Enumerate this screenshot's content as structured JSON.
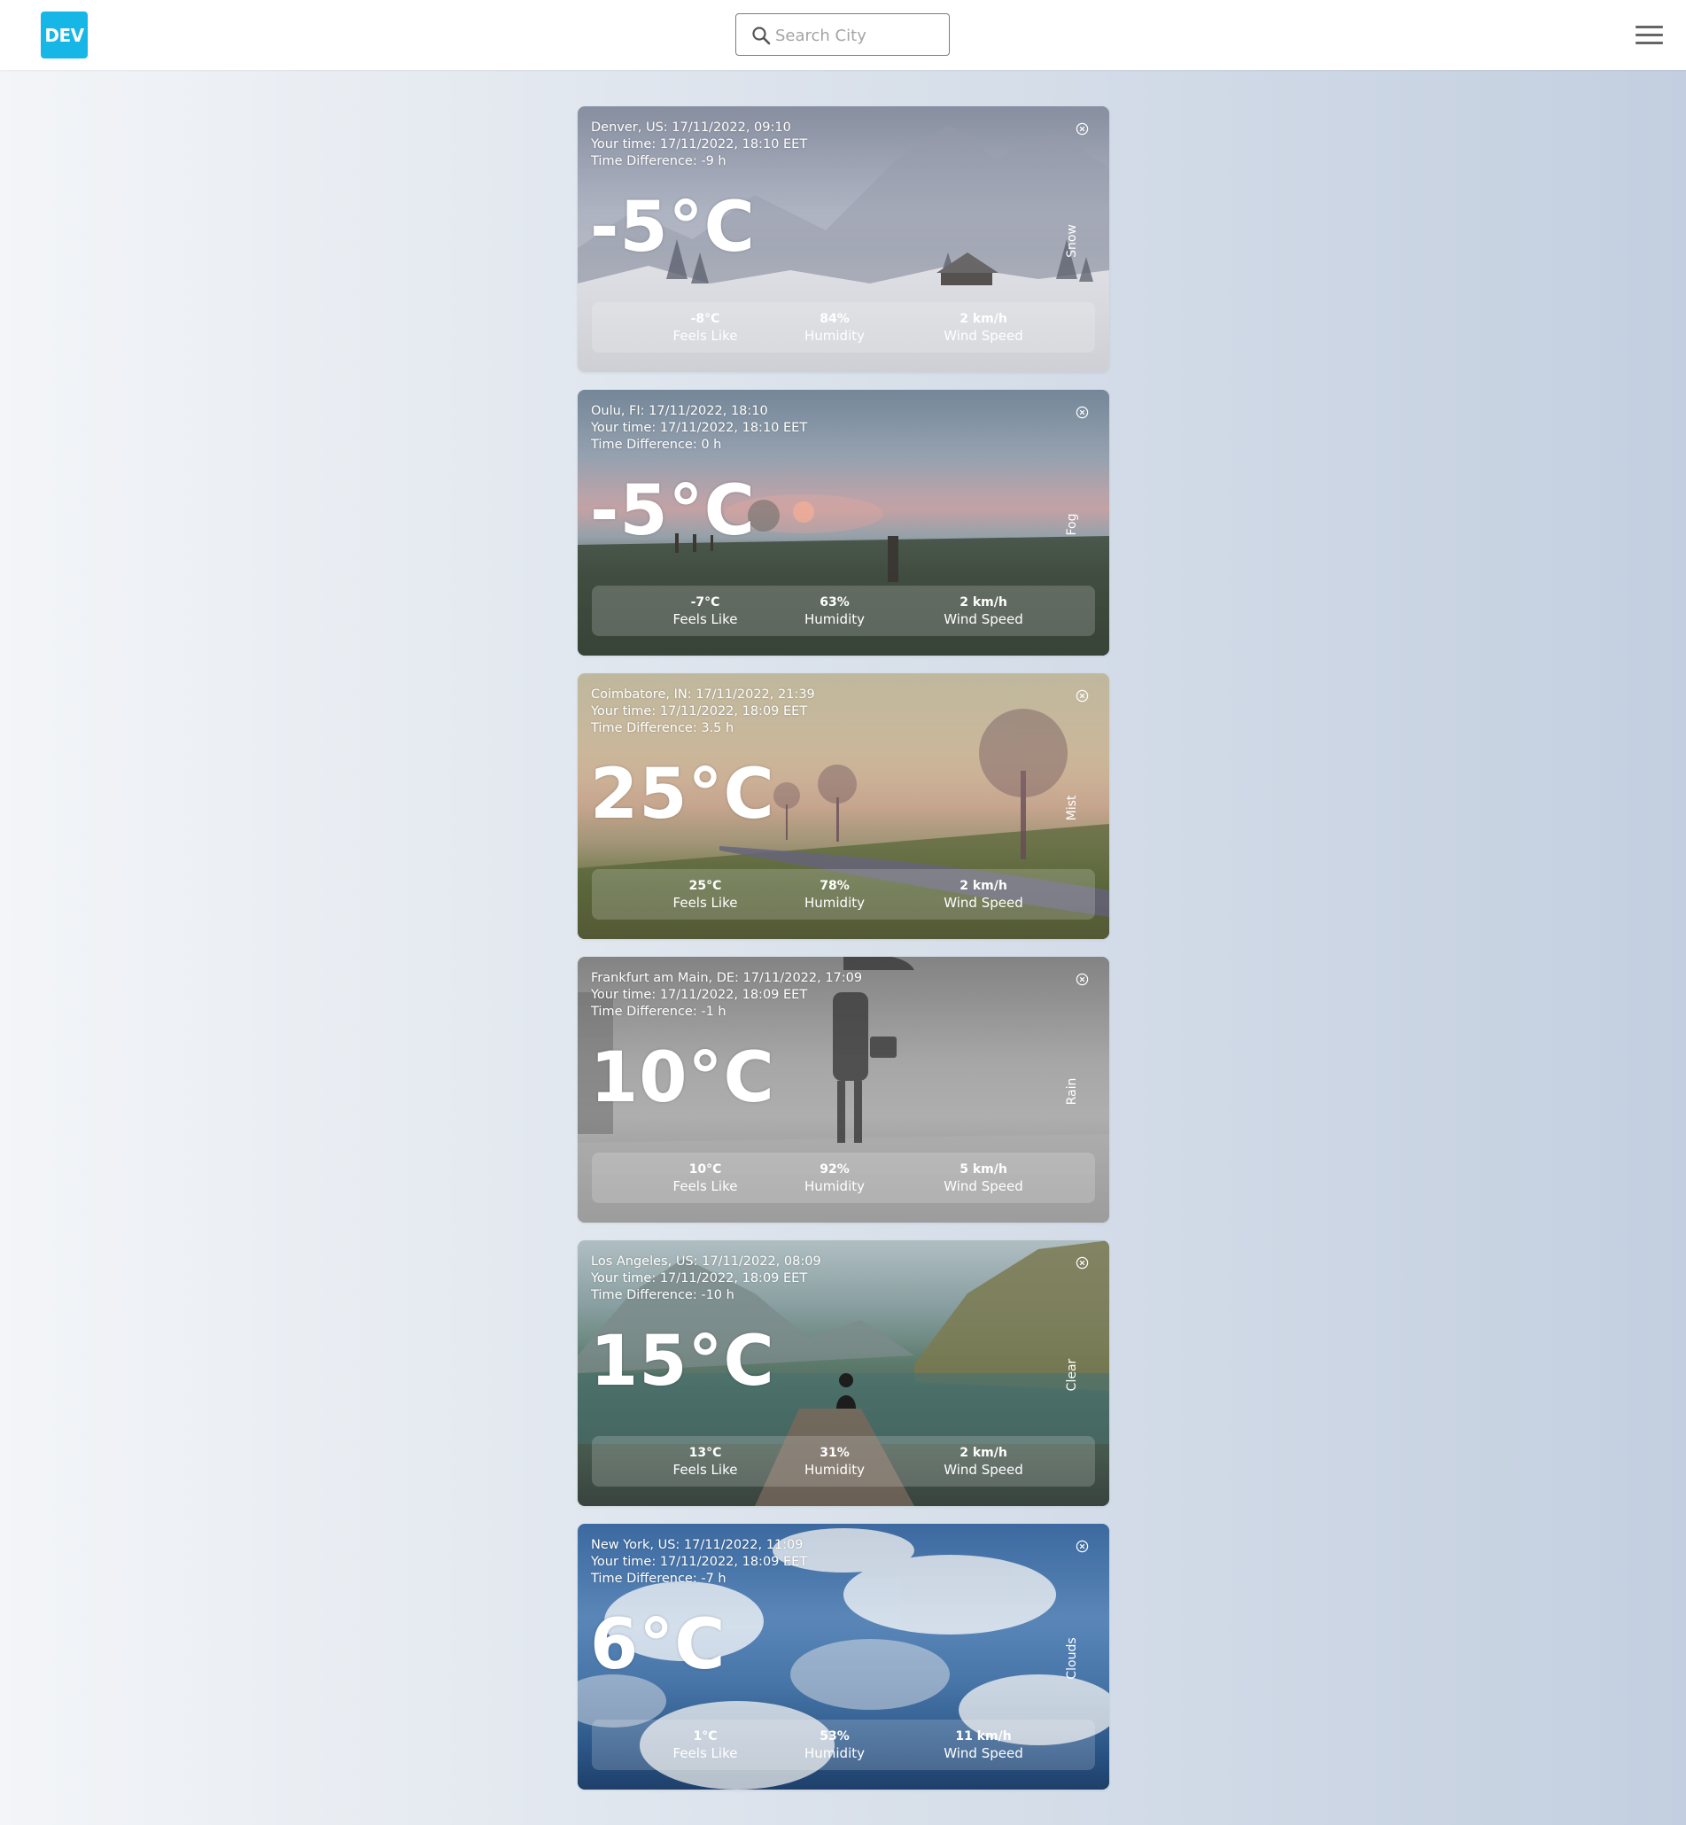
{
  "header": {
    "logo_text": "DEV",
    "search_placeholder": "Search City",
    "brand_color": "#16b6e6"
  },
  "labels": {
    "feels_like": "Feels Like",
    "humidity": "Humidity",
    "wind_speed": "Wind Speed"
  },
  "cards": [
    {
      "location_line": "Denver, US: 17/11/2022, 09:10",
      "your_time": "Your time: 17/11/2022, 18:10 EET",
      "time_difference": "Time Difference: -9 h",
      "temperature": "-5°C",
      "condition": "Snow",
      "feels_like": "-8°C",
      "humidity": "84%",
      "wind_speed": "2 km/h"
    },
    {
      "location_line": "Oulu, FI: 17/11/2022, 18:10",
      "your_time": "Your time: 17/11/2022, 18:10 EET",
      "time_difference": "Time Difference: 0 h",
      "temperature": "-5°C",
      "condition": "Fog",
      "feels_like": "-7°C",
      "humidity": "63%",
      "wind_speed": "2 km/h"
    },
    {
      "location_line": "Coimbatore, IN: 17/11/2022, 21:39",
      "your_time": "Your time: 17/11/2022, 18:09 EET",
      "time_difference": "Time Difference: 3.5 h",
      "temperature": "25°C",
      "condition": "Mist",
      "feels_like": "25°C",
      "humidity": "78%",
      "wind_speed": "2 km/h"
    },
    {
      "location_line": "Frankfurt am Main, DE: 17/11/2022, 17:09",
      "your_time": "Your time: 17/11/2022, 18:09 EET",
      "time_difference": "Time Difference: -1 h",
      "temperature": "10°C",
      "condition": "Rain",
      "feels_like": "10°C",
      "humidity": "92%",
      "wind_speed": "5 km/h"
    },
    {
      "location_line": "Los Angeles, US: 17/11/2022, 08:09",
      "your_time": "Your time: 17/11/2022, 18:09 EET",
      "time_difference": "Time Difference: -10 h",
      "temperature": "15°C",
      "condition": "Clear",
      "feels_like": "13°C",
      "humidity": "31%",
      "wind_speed": "2 km/h"
    },
    {
      "location_line": "New York, US: 17/11/2022, 11:09",
      "your_time": "Your time: 17/11/2022, 18:09 EET",
      "time_difference": "Time Difference: -7 h",
      "temperature": "6°C",
      "condition": "Clouds",
      "feels_like": "1°C",
      "humidity": "53%",
      "wind_speed": "11 km/h"
    }
  ]
}
